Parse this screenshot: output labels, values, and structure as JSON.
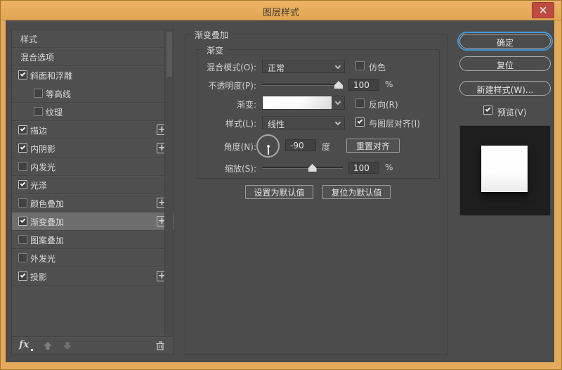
{
  "window": {
    "title": "图层样式",
    "close_glyph": "×"
  },
  "sidebar": {
    "items": [
      {
        "label": "样式",
        "checkbox": false,
        "checked": false,
        "plus": false,
        "indent": false,
        "selected": false
      },
      {
        "label": "混合选项",
        "checkbox": false,
        "checked": false,
        "plus": false,
        "indent": false,
        "selected": false
      },
      {
        "label": "斜面和浮雕",
        "checkbox": true,
        "checked": true,
        "plus": false,
        "indent": false,
        "selected": false
      },
      {
        "label": "等高线",
        "checkbox": true,
        "checked": false,
        "plus": false,
        "indent": true,
        "selected": false
      },
      {
        "label": "纹理",
        "checkbox": true,
        "checked": false,
        "plus": false,
        "indent": true,
        "selected": false
      },
      {
        "label": "描边",
        "checkbox": true,
        "checked": true,
        "plus": true,
        "indent": false,
        "selected": false
      },
      {
        "label": "内阴影",
        "checkbox": true,
        "checked": true,
        "plus": true,
        "indent": false,
        "selected": false
      },
      {
        "label": "内发光",
        "checkbox": true,
        "checked": false,
        "plus": false,
        "indent": false,
        "selected": false
      },
      {
        "label": "光泽",
        "checkbox": true,
        "checked": true,
        "plus": false,
        "indent": false,
        "selected": false
      },
      {
        "label": "颜色叠加",
        "checkbox": true,
        "checked": false,
        "plus": true,
        "indent": false,
        "selected": false
      },
      {
        "label": "渐变叠加",
        "checkbox": true,
        "checked": true,
        "plus": true,
        "indent": false,
        "selected": true
      },
      {
        "label": "图案叠加",
        "checkbox": true,
        "checked": false,
        "plus": false,
        "indent": false,
        "selected": false
      },
      {
        "label": "外发光",
        "checkbox": true,
        "checked": false,
        "plus": false,
        "indent": false,
        "selected": false
      },
      {
        "label": "投影",
        "checkbox": true,
        "checked": true,
        "plus": true,
        "indent": false,
        "selected": false
      }
    ],
    "plus_glyph": "+",
    "footer": {
      "fx_label": "fx"
    }
  },
  "panel": {
    "title": "渐变叠加",
    "group_title": "渐变",
    "blend_mode": {
      "label": "混合模式(O):",
      "value": "正常",
      "dither_label": "仿色",
      "dither_checked": false
    },
    "opacity": {
      "label": "不透明度(P):",
      "value": "100",
      "unit": "%"
    },
    "gradient": {
      "label": "渐变:",
      "reverse_label": "反向(R)",
      "reverse_checked": false
    },
    "style": {
      "label": "样式(L):",
      "value": "线性",
      "align_label": "与图层对齐(I)",
      "align_checked": true
    },
    "angle": {
      "label": "角度(N):",
      "value": "-90",
      "unit": "度",
      "reset_button": "重置对齐"
    },
    "scale": {
      "label": "缩放(S):",
      "value": "100",
      "unit": "%"
    },
    "buttons": {
      "set_default": "设置为默认值",
      "reset_default": "复位为默认值"
    }
  },
  "actions": {
    "ok": "确定",
    "reset": "复位",
    "new_style": "新建样式(W)...",
    "preview_label": "预览(V)",
    "preview_checked": true
  },
  "colors": {
    "frame_orange": "#e5ab5b",
    "close_red": "#bf4b42",
    "focus_blue": "#4596d3",
    "selected_row": "#6d6d6d",
    "dialog_bg": "#4c4c4c"
  }
}
